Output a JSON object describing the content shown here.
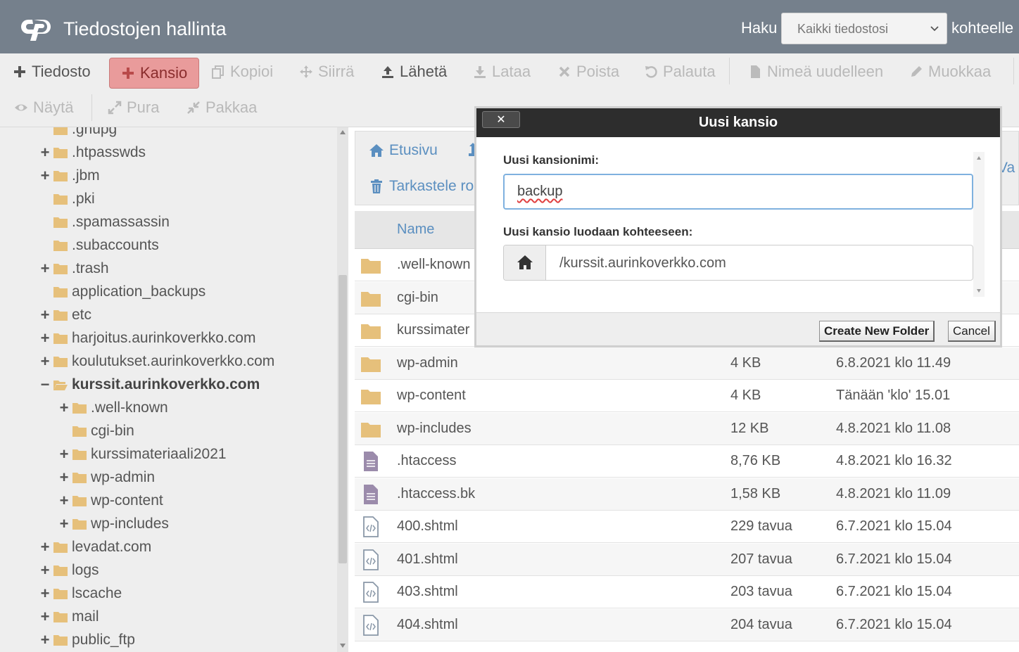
{
  "header": {
    "app_title": "Tiedostojen hallinta",
    "search_label": "Haku",
    "search_scope": "Kaikki tiedostosi",
    "search_suffix": "kohteelle"
  },
  "toolbar": {
    "file": "Tiedosto",
    "folder": "Kansio",
    "copy": "Kopioi",
    "move": "Siirrä",
    "upload": "Lähetä",
    "download": "Lataa",
    "delete": "Poista",
    "restore": "Palauta",
    "rename": "Nimeä uudelleen",
    "edit": "Muokkaa",
    "view": "Näytä",
    "extract": "Pura",
    "compress": "Pakkaa"
  },
  "tree": [
    {
      "name": ".gnupg",
      "expander": "",
      "bold": false
    },
    {
      "name": ".htpasswds",
      "expander": "+",
      "bold": false
    },
    {
      "name": ".jbm",
      "expander": "+",
      "bold": false
    },
    {
      "name": ".pki",
      "expander": "",
      "bold": false
    },
    {
      "name": ".spamassassin",
      "expander": "",
      "bold": false
    },
    {
      "name": ".subaccounts",
      "expander": "",
      "bold": false
    },
    {
      "name": ".trash",
      "expander": "+",
      "bold": false
    },
    {
      "name": "application_backups",
      "expander": "",
      "bold": false
    },
    {
      "name": "etc",
      "expander": "+",
      "bold": false
    },
    {
      "name": "harjoitus.aurinkoverkko.com",
      "expander": "+",
      "bold": false
    },
    {
      "name": "koulutukset.aurinkoverkko.com",
      "expander": "+",
      "bold": false
    },
    {
      "name": "kurssit.aurinkoverkko.com",
      "expander": "−",
      "bold": true
    },
    {
      "name": ".well-known",
      "expander": "+",
      "bold": false
    },
    {
      "name": "cgi-bin",
      "expander": "",
      "bold": false
    },
    {
      "name": "kurssimateriaali2021",
      "expander": "+",
      "bold": false
    },
    {
      "name": "wp-admin",
      "expander": "+",
      "bold": false
    },
    {
      "name": "wp-content",
      "expander": "+",
      "bold": false
    },
    {
      "name": "wp-includes",
      "expander": "+",
      "bold": false
    },
    {
      "name": "levadat.com",
      "expander": "+",
      "bold": false
    },
    {
      "name": "logs",
      "expander": "+",
      "bold": false
    },
    {
      "name": "lscache",
      "expander": "+",
      "bold": false
    },
    {
      "name": "mail",
      "expander": "+",
      "bold": false
    },
    {
      "name": "public_ftp",
      "expander": "+",
      "bold": false
    }
  ],
  "nav": {
    "home": "Etusivu",
    "trash": "Tarkastele ro",
    "partial": "l Va"
  },
  "table": {
    "name_header": "Name",
    "rows": [
      {
        "name": ".well-known",
        "size": "",
        "date": "",
        "type": "folder"
      },
      {
        "name": "cgi-bin",
        "size": "",
        "date": "",
        "type": "folder"
      },
      {
        "name": "kurssimater",
        "size": "",
        "date": "",
        "type": "folder"
      },
      {
        "name": "wp-admin",
        "size": "4 KB",
        "date": "6.8.2021 klo 11.49",
        "type": "folder"
      },
      {
        "name": "wp-content",
        "size": "4 KB",
        "date": "Tänään 'klo' 15.01",
        "type": "folder"
      },
      {
        "name": "wp-includes",
        "size": "12 KB",
        "date": "4.8.2021 klo 11.08",
        "type": "folder"
      },
      {
        "name": ".htaccess",
        "size": "8,76 KB",
        "date": "4.8.2021 klo 16.32",
        "type": "text"
      },
      {
        "name": ".htaccess.bk",
        "size": "1,58 KB",
        "date": "4.8.2021 klo 11.09",
        "type": "text"
      },
      {
        "name": "400.shtml",
        "size": "229 tavua",
        "date": "6.7.2021 klo 15.04",
        "type": "code"
      },
      {
        "name": "401.shtml",
        "size": "207 tavua",
        "date": "6.7.2021 klo 15.04",
        "type": "code"
      },
      {
        "name": "403.shtml",
        "size": "203 tavua",
        "date": "6.7.2021 klo 15.04",
        "type": "code"
      },
      {
        "name": "404.shtml",
        "size": "204 tavua",
        "date": "6.7.2021 klo 15.04",
        "type": "code"
      }
    ]
  },
  "modal": {
    "title": "Uusi kansio",
    "close_glyph": "✕",
    "name_label": "Uusi kansionimi:",
    "name_value": "backup",
    "path_label": "Uusi kansio luodaan kohteeseen:",
    "path_value": "/kurssit.aurinkoverkko.com",
    "create_button": "Create New Folder",
    "cancel_button": "Cancel"
  },
  "colors": {
    "header_bg": "#75808c",
    "folder": "#e6c07b",
    "link": "#5b8fc0",
    "active_button": "#e99b9b",
    "file_icon": "#9b8bab"
  }
}
